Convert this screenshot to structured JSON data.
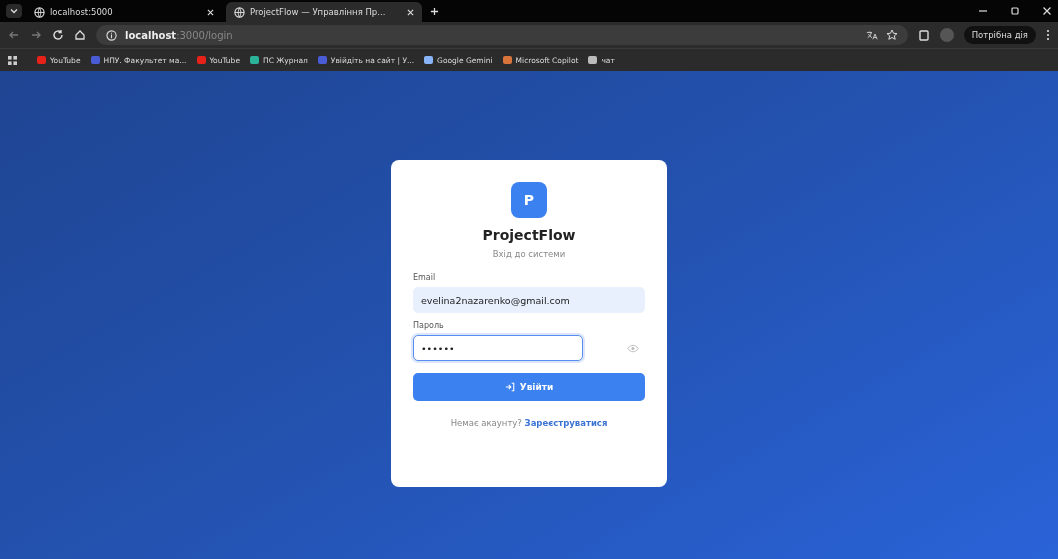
{
  "browser": {
    "tabs": [
      {
        "title": "localhost:5000",
        "selected": false
      },
      {
        "title": "ProjectFlow — Управління Пр...",
        "selected": true
      }
    ],
    "address": {
      "host": "localhost",
      "path": ":3000/login"
    },
    "profile_button": "Потрібна дія",
    "bookmarks": [
      {
        "label": "YouTube",
        "kind": "youtube"
      },
      {
        "label": "НПУ. Факультет ма...",
        "kind": "site"
      },
      {
        "label": "YouTube",
        "kind": "youtube"
      },
      {
        "label": "ПС Журнал",
        "kind": "journal"
      },
      {
        "label": "Увійдіть на сайт | У...",
        "kind": "site"
      },
      {
        "label": "Google Gemini",
        "kind": "gemini"
      },
      {
        "label": "Microsoft Copilot",
        "kind": "copilot"
      },
      {
        "label": "чат",
        "kind": "chat"
      }
    ]
  },
  "login": {
    "logo_letter": "P",
    "title": "ProjectFlow",
    "subtitle": "Вхід до системи",
    "fields": [
      {
        "label": "Email",
        "value": "evelina2nazarenko@gmail.com",
        "kind": "email",
        "focused": false,
        "autofilled": true
      },
      {
        "label": "Пароль",
        "value": "••••••",
        "kind": "password",
        "focused": true,
        "autofilled": false
      }
    ],
    "submit": "Увійти",
    "footer_text": "Немає акаунту?",
    "footer_link": "Зареєструватися"
  }
}
